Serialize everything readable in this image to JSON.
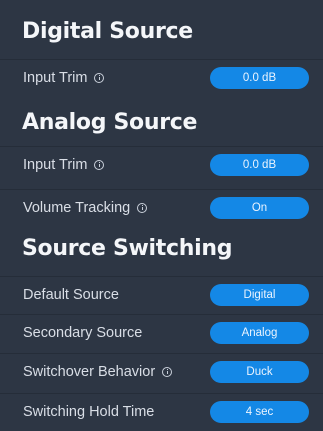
{
  "digital_source": {
    "title": "Digital Source",
    "input_trim": {
      "label": "Input Trim",
      "value": "0.0 dB"
    }
  },
  "analog_source": {
    "title": "Analog Source",
    "input_trim": {
      "label": "Input Trim",
      "value": "0.0 dB"
    },
    "volume_tracking": {
      "label": "Volume Tracking",
      "value": "On"
    }
  },
  "source_switching": {
    "title": "Source Switching",
    "default_source": {
      "label": "Default Source",
      "value": "Digital"
    },
    "secondary_source": {
      "label": "Secondary Source",
      "value": "Analog"
    },
    "switchover_behavior": {
      "label": "Switchover Behavior",
      "value": "Duck"
    },
    "switching_hold_time": {
      "label": "Switching Hold Time",
      "value": "4 sec"
    }
  },
  "colors": {
    "background": "#2d3644",
    "accent": "#1488e6"
  }
}
